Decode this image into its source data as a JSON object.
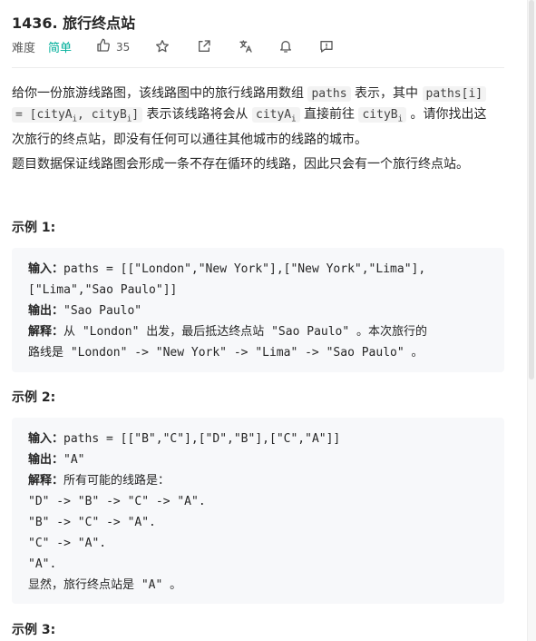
{
  "problem": {
    "title": "1436. 旅行终点站",
    "difficulty_label": "难度",
    "difficulty": "简单",
    "likes": "35",
    "difficulty_color": "#00af9b"
  },
  "description": {
    "p1_a": "给你一份旅游线路图，该线路图中的旅行线路用数组 ",
    "p1_code1": "paths",
    "p1_b": " 表示，其中 ",
    "p1_code2": "paths[i]",
    "p1_code3": "= [cityA",
    "p1_sub1": "i",
    "p1_code3b": ", cityB",
    "p1_sub2": "i",
    "p1_code3c": "]",
    "p1_c": " 表示该线路将会从 ",
    "p1_code4": "cityA",
    "p1_sub3": "i",
    "p1_d": " 直接前往 ",
    "p1_code5": "cityB",
    "p1_sub4": "i",
    "p1_e": " 。请你找出这",
    "p1_f": "次旅行的终点站，即没有任何可以通往其他城市的线路的城市。",
    "p2": "题目数据保证线路图会形成一条不存在循环的线路，因此只会有一个旅行终点站。"
  },
  "examples": [
    {
      "title": "示例 1:",
      "input_label": "输入：",
      "input_line1": "paths = [[\"London\",\"New York\"],[\"New York\",\"Lima\"],",
      "input_line2": "[\"Lima\",\"Sao Paulo\"]]",
      "output_label": "输出：",
      "output": "\"Sao Paulo\"",
      "explain_label": "解释：",
      "explain_line1": "从 \"London\" 出发，最后抵达终点站 \"Sao Paulo\" 。本次旅行的",
      "explain_line2": "路线是 \"London\" -> \"New York\" -> \"Lima\" -> \"Sao Paulo\" 。"
    },
    {
      "title": "示例 2:",
      "input_label": "输入：",
      "input_line1": "paths = [[\"B\",\"C\"],[\"D\",\"B\"],[\"C\",\"A\"]]",
      "output_label": "输出：",
      "output": "\"A\"",
      "explain_label": "解释：",
      "explain_line1": "所有可能的线路是：",
      "lines": [
        "\"D\" -> \"B\" -> \"C\" -> \"A\".",
        "\"B\" -> \"C\" -> \"A\".",
        "\"C\" -> \"A\".",
        "\"A\".",
        "显然，旅行终点站是 \"A\" 。"
      ]
    },
    {
      "title": "示例 3:"
    }
  ],
  "icons": {
    "like": "thumbs-up-icon",
    "star": "star-icon",
    "share": "share-icon",
    "translate": "translate-icon",
    "bell": "bell-icon",
    "comment": "comment-icon"
  }
}
